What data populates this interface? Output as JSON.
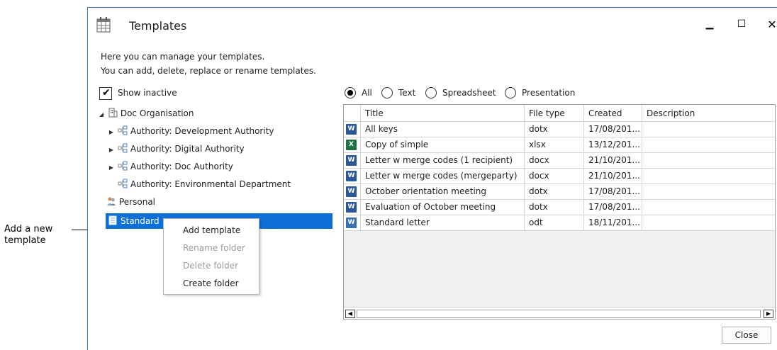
{
  "callout": {
    "line1": "Add a new",
    "line2": "template"
  },
  "window": {
    "title": "Templates",
    "minimize_glyph": "▁",
    "maximize_glyph": "☐",
    "close_glyph": "✕"
  },
  "intro": {
    "line1": "Here you can manage your templates.",
    "line2": "You can add, delete, replace or rename templates."
  },
  "show_inactive": {
    "label": "Show inactive",
    "checked": true
  },
  "tree": {
    "root": "Doc Organisation",
    "items": [
      {
        "label": "Authority: Development Authority",
        "expandable": true
      },
      {
        "label": "Authority: Digital Authority",
        "expandable": true
      },
      {
        "label": "Authority: Doc Authority",
        "expandable": true
      },
      {
        "label": "Authority: Environmental Department",
        "expandable": false
      }
    ],
    "personal": "Personal",
    "standard": "Standard",
    "selected": "Standard"
  },
  "context_menu": {
    "items": [
      {
        "label": "Add template",
        "enabled": true
      },
      {
        "label": "Rename folder",
        "enabled": false
      },
      {
        "label": "Delete folder",
        "enabled": false
      },
      {
        "label": "Create folder",
        "enabled": true
      }
    ]
  },
  "filter": {
    "options": [
      "All",
      "Text",
      "Spreadsheet",
      "Presentation"
    ],
    "selected": "All"
  },
  "grid": {
    "columns": [
      "Title",
      "File type",
      "Created",
      "Description"
    ],
    "rows": [
      {
        "icon": "word-icon",
        "title": "All keys",
        "type": "dotx",
        "created": "17/08/201...",
        "description": ""
      },
      {
        "icon": "excel-icon",
        "title": "Copy of simple",
        "type": "xlsx",
        "created": "13/12/201...",
        "description": ""
      },
      {
        "icon": "word-icon",
        "title": "Letter w merge codes (1 recipient)",
        "type": "docx",
        "created": "21/10/201...",
        "description": ""
      },
      {
        "icon": "word-icon",
        "title": "Letter w merge codes (mergeparty)",
        "type": "docx",
        "created": "21/10/201...",
        "description": ""
      },
      {
        "icon": "word-icon",
        "title": "October orientation meeting",
        "type": "dotx",
        "created": "17/08/201...",
        "description": ""
      },
      {
        "icon": "word-icon",
        "title": "Evaluation of October meeting",
        "type": "dotx",
        "created": "17/08/201...",
        "description": ""
      },
      {
        "icon": "odt-icon",
        "title": "Standard letter",
        "type": "odt",
        "created": "18/11/201...",
        "description": ""
      }
    ]
  },
  "scroll": {
    "left": "◀",
    "right": "▶"
  },
  "buttons": {
    "close": "Close"
  },
  "colors": {
    "selection": "#0e70d6",
    "window_border": "#3c7bc2"
  }
}
